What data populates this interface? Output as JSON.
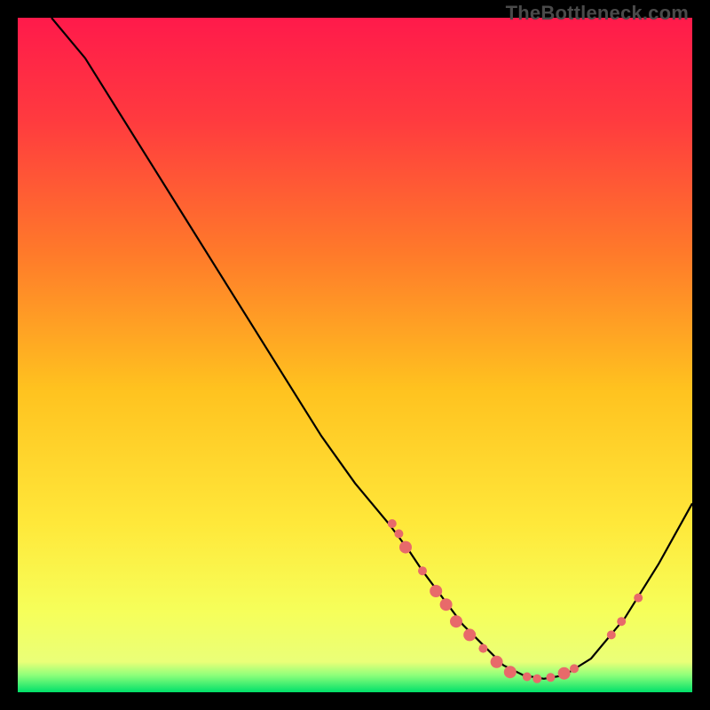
{
  "watermark": "TheBottleneck.com",
  "chart_data": {
    "type": "line",
    "title": "",
    "xlabel": "",
    "ylabel": "",
    "xlim": [
      0,
      100
    ],
    "ylim": [
      0,
      100
    ],
    "grid": false,
    "legend": false,
    "gradient_stops": [
      {
        "offset": 0.0,
        "color": "#ff1a4b"
      },
      {
        "offset": 0.15,
        "color": "#ff3a3f"
      },
      {
        "offset": 0.35,
        "color": "#ff7a2a"
      },
      {
        "offset": 0.55,
        "color": "#ffc21f"
      },
      {
        "offset": 0.75,
        "color": "#ffe83a"
      },
      {
        "offset": 0.88,
        "color": "#f6ff5a"
      },
      {
        "offset": 0.955,
        "color": "#eaff78"
      },
      {
        "offset": 0.975,
        "color": "#8cff7a"
      },
      {
        "offset": 1.0,
        "color": "#00e06a"
      }
    ],
    "series": [
      {
        "name": "bottleneck-curve",
        "color": "#000000",
        "x": [
          5,
          10,
          15,
          20,
          25,
          30,
          35,
          40,
          45,
          50,
          55,
          58,
          60,
          63,
          66,
          69,
          72,
          75,
          78,
          81,
          85,
          90,
          95,
          100
        ],
        "y": [
          100,
          94,
          86,
          78,
          70,
          62,
          54,
          46,
          38,
          31,
          25,
          21,
          18,
          14,
          10,
          7,
          4,
          2.5,
          2,
          2.5,
          5,
          11,
          19,
          28
        ]
      }
    ],
    "scatter": {
      "name": "gpu-markers",
      "color": "#e86a6a",
      "points": [
        {
          "x": 55.5,
          "y": 25.0,
          "r": 5
        },
        {
          "x": 56.5,
          "y": 23.5,
          "r": 5
        },
        {
          "x": 57.5,
          "y": 21.5,
          "r": 7
        },
        {
          "x": 60.0,
          "y": 18.0,
          "r": 5
        },
        {
          "x": 62.0,
          "y": 15.0,
          "r": 7
        },
        {
          "x": 63.5,
          "y": 13.0,
          "r": 7
        },
        {
          "x": 65.0,
          "y": 10.5,
          "r": 7
        },
        {
          "x": 67.0,
          "y": 8.5,
          "r": 7
        },
        {
          "x": 69.0,
          "y": 6.5,
          "r": 5
        },
        {
          "x": 71.0,
          "y": 4.5,
          "r": 7
        },
        {
          "x": 73.0,
          "y": 3.0,
          "r": 7
        },
        {
          "x": 75.5,
          "y": 2.3,
          "r": 5
        },
        {
          "x": 77.0,
          "y": 2.0,
          "r": 5
        },
        {
          "x": 79.0,
          "y": 2.2,
          "r": 5
        },
        {
          "x": 81.0,
          "y": 2.8,
          "r": 7
        },
        {
          "x": 82.5,
          "y": 3.5,
          "r": 5
        },
        {
          "x": 88.0,
          "y": 8.5,
          "r": 5
        },
        {
          "x": 89.5,
          "y": 10.5,
          "r": 5
        },
        {
          "x": 92.0,
          "y": 14.0,
          "r": 5
        }
      ]
    }
  }
}
